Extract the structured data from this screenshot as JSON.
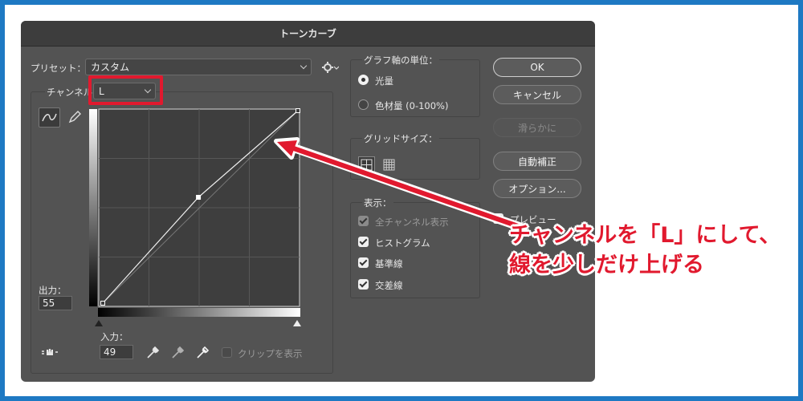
{
  "dialog": {
    "title": "トーンカーブ",
    "preset_label": "プリセット：",
    "preset_value": "カスタム",
    "channel_label": "チャンネル：",
    "channel_value": "L",
    "output_label": "出力：",
    "output_value": "55",
    "input_label": "入力：",
    "input_value": "49",
    "show_clipping_label": "クリップを表示",
    "graph_unit": {
      "title": "グラフ軸の単位：",
      "options": [
        "光量",
        "色材量 (0-100%)"
      ],
      "selected": "光量"
    },
    "grid_size": {
      "title": "グリッドサイズ："
    },
    "display": {
      "title": "表示：",
      "items": [
        {
          "label": "全チャンネル表示",
          "checked": true,
          "disabled": true
        },
        {
          "label": "ヒストグラム",
          "checked": true,
          "disabled": false
        },
        {
          "label": "基準線",
          "checked": true,
          "disabled": false
        },
        {
          "label": "交差線",
          "checked": true,
          "disabled": false
        }
      ]
    },
    "buttons": {
      "ok": "OK",
      "cancel": "キャンセル",
      "smooth": "滑らかに",
      "auto": "自動補正",
      "options": "オプション..."
    },
    "preview_label": "プレビュー"
  },
  "annotation": {
    "line1": "チャンネルを「L」にして、",
    "line2": "線を少しだけ上げる",
    "color": "#e1192e"
  },
  "curve": {
    "points": [
      [
        0,
        0
      ],
      [
        49,
        55
      ],
      [
        100,
        100
      ]
    ]
  }
}
